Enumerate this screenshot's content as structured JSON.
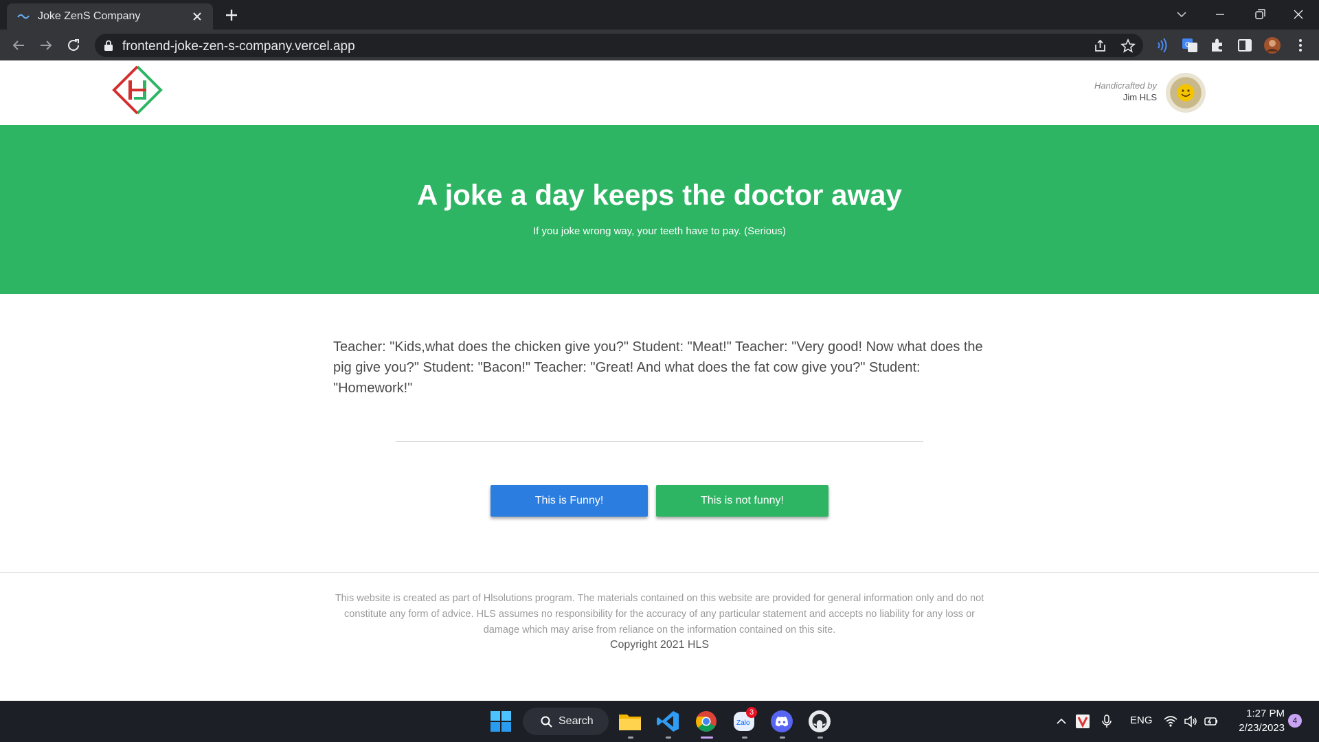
{
  "browser": {
    "tab_title": "Joke ZenS Company",
    "url": "frontend-joke-zen-s-company.vercel.app"
  },
  "header": {
    "credit_label": "Handicrafted by",
    "credit_name": "Jim HLS"
  },
  "hero": {
    "title": "A joke a day keeps the doctor away",
    "subtitle": "If you joke wrong way, your teeth have to pay. (Serious)"
  },
  "joke": {
    "text": "Teacher: \"Kids,what does the chicken give you?\" Student: \"Meat!\" Teacher: \"Very good! Now what does the pig give you?\" Student: \"Bacon!\" Teacher: \"Great! And what does the fat cow give you?\" Student: \"Homework!\""
  },
  "actions": {
    "funny_label": "This is Funny!",
    "not_funny_label": "This is not funny!"
  },
  "footer": {
    "disclaimer": "This website is created as part of Hlsolutions program. The materials contained on this website are provided for general information only and do not constitute any form of advice. HLS assumes no responsibility for the accuracy of any particular statement and accepts no liability for any loss or damage which may arise from reliance on the information contained on this site.",
    "copyright": "Copyright 2021 HLS"
  },
  "taskbar": {
    "search_label": "Search",
    "zalo_badge": "3",
    "language": "ENG",
    "time": "1:27 PM",
    "date": "2/23/2023",
    "notification_count": "4"
  },
  "colors": {
    "hero_green": "#2db564",
    "funny_blue": "#2c7de0",
    "not_funny_green": "#2db564",
    "chrome_dark": "#202124"
  }
}
